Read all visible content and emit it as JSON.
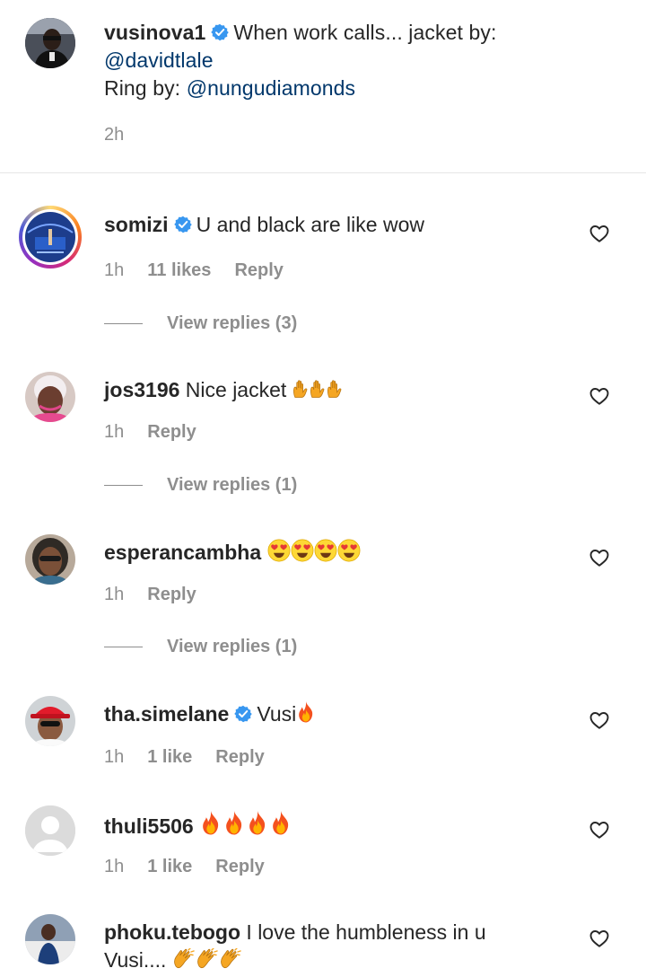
{
  "caption": {
    "username": "vusinova1",
    "text_line1": "When work calls... jacket by:",
    "mention1": "@davidtlale",
    "ring_prefix": "Ring by:",
    "mention2": "@nungudiamonds",
    "time": "2h"
  },
  "comments": [
    {
      "username": "somizi",
      "verified": true,
      "text": "U and black are like wow",
      "time": "1h",
      "likes": "11 likes",
      "reply": "Reply",
      "view_replies": "View replies (3)"
    },
    {
      "username": "jos3196",
      "verified": false,
      "text": "Nice jacket",
      "emoji": "raising-hands x3",
      "time": "1h",
      "reply": "Reply",
      "view_replies": "View replies (1)"
    },
    {
      "username": "esperancambha",
      "verified": false,
      "text": "",
      "emoji": "heart-eyes x4",
      "time": "1h",
      "reply": "Reply",
      "view_replies": "View replies (1)"
    },
    {
      "username": "tha.simelane",
      "verified": true,
      "text": "Vusi",
      "emoji": "fire x1",
      "time": "1h",
      "likes": "1 like",
      "reply": "Reply"
    },
    {
      "username": "thuli5506",
      "verified": false,
      "text": "",
      "emoji": "fire x4",
      "time": "1h",
      "likes": "1 like",
      "reply": "Reply"
    },
    {
      "username": "phoku.tebogo",
      "verified": false,
      "text_line1": "I love the humbleness in u",
      "text_line2": "Vusi....",
      "emoji": "clapping-hands x3"
    }
  ],
  "colors": {
    "text": "#262626",
    "secondary": "#8e8e8e",
    "mention": "#00376b",
    "verified": "#3897f0",
    "divider": "#e6e6e6"
  }
}
